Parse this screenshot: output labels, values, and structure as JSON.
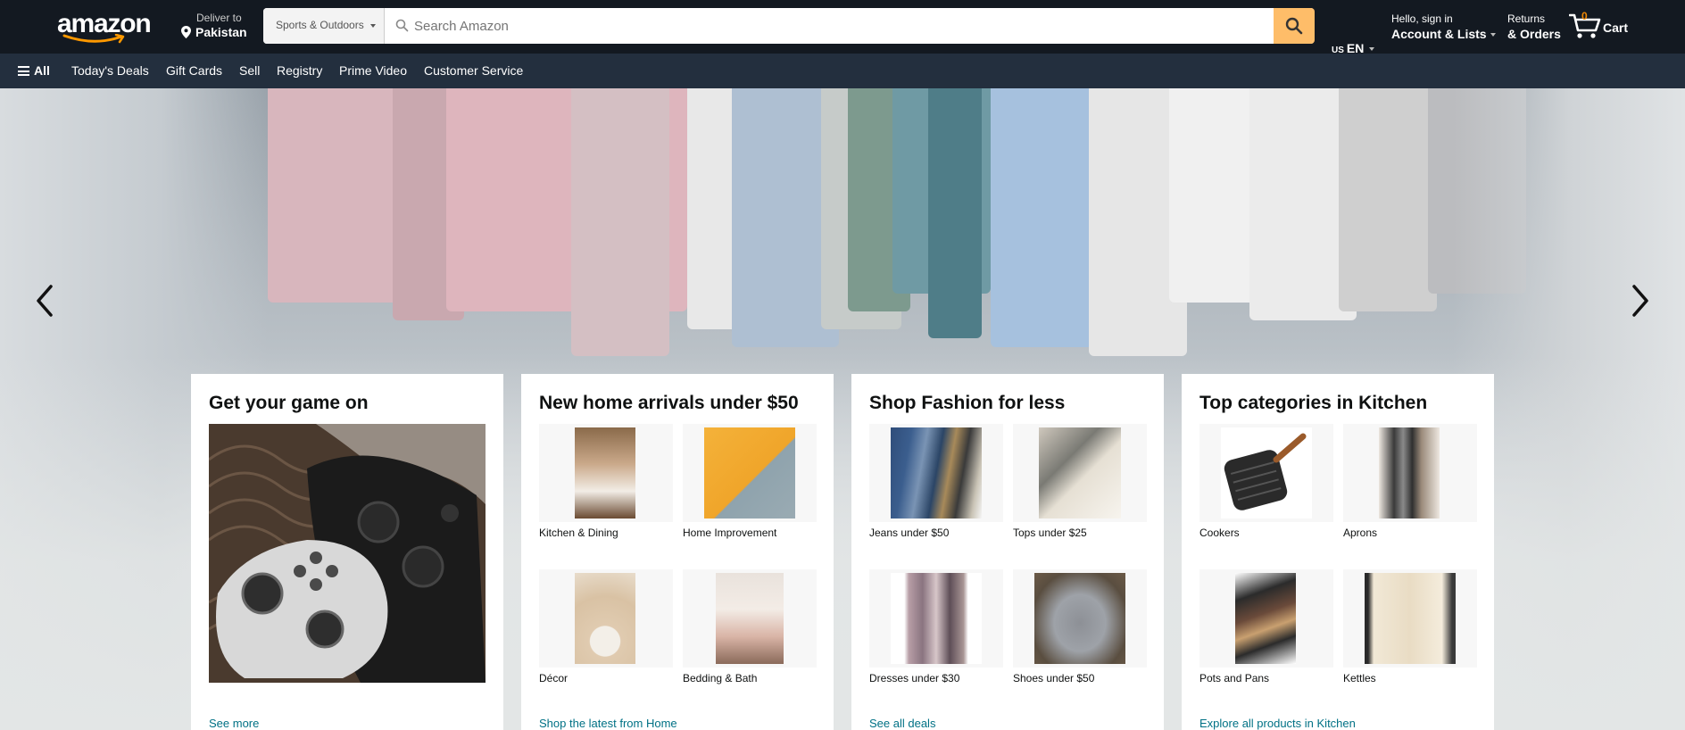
{
  "header": {
    "logo_text": "amazon",
    "deliver_line1": "Deliver to",
    "deliver_line2": "Pakistan",
    "search_category": "Sports & Outdoors",
    "search_placeholder": "Search Amazon",
    "lang_flag": "US",
    "lang_code": "EN",
    "account_line1": "Hello, sign in",
    "account_line2": "Account & Lists",
    "returns_line1": "Returns",
    "returns_line2": "& Orders",
    "cart_count": "0",
    "cart_label": "Cart"
  },
  "subnav": {
    "all_label": "All",
    "items": [
      "Today's Deals",
      "Gift Cards",
      "Sell",
      "Registry",
      "Prime Video",
      "Customer Service"
    ]
  },
  "cards": [
    {
      "title": "Get your game on",
      "link": "See more"
    },
    {
      "title": "New home arrivals under $50",
      "tiles": [
        "Kitchen & Dining",
        "Home Improvement",
        "Décor",
        "Bedding & Bath"
      ],
      "link": "Shop the latest from Home"
    },
    {
      "title": "Shop Fashion for less",
      "tiles": [
        "Jeans under $50",
        "Tops under $25",
        "Dresses under $30",
        "Shoes under $50"
      ],
      "link": "See all deals"
    },
    {
      "title": "Top categories in Kitchen",
      "tiles": [
        "Cookers",
        "Aprons",
        "Pots and Pans",
        "Kettles"
      ],
      "link": "Explore all products in Kitchen"
    }
  ],
  "colors": {
    "nav_bg": "#131921",
    "subnav_bg": "#232f3e",
    "accent": "#febd69",
    "cart_count": "#f08804",
    "link": "#007185"
  },
  "icons": [
    "location-pin-icon",
    "search-icon",
    "cart-icon",
    "hamburger-icon",
    "chevron-left-icon",
    "chevron-right-icon"
  ]
}
